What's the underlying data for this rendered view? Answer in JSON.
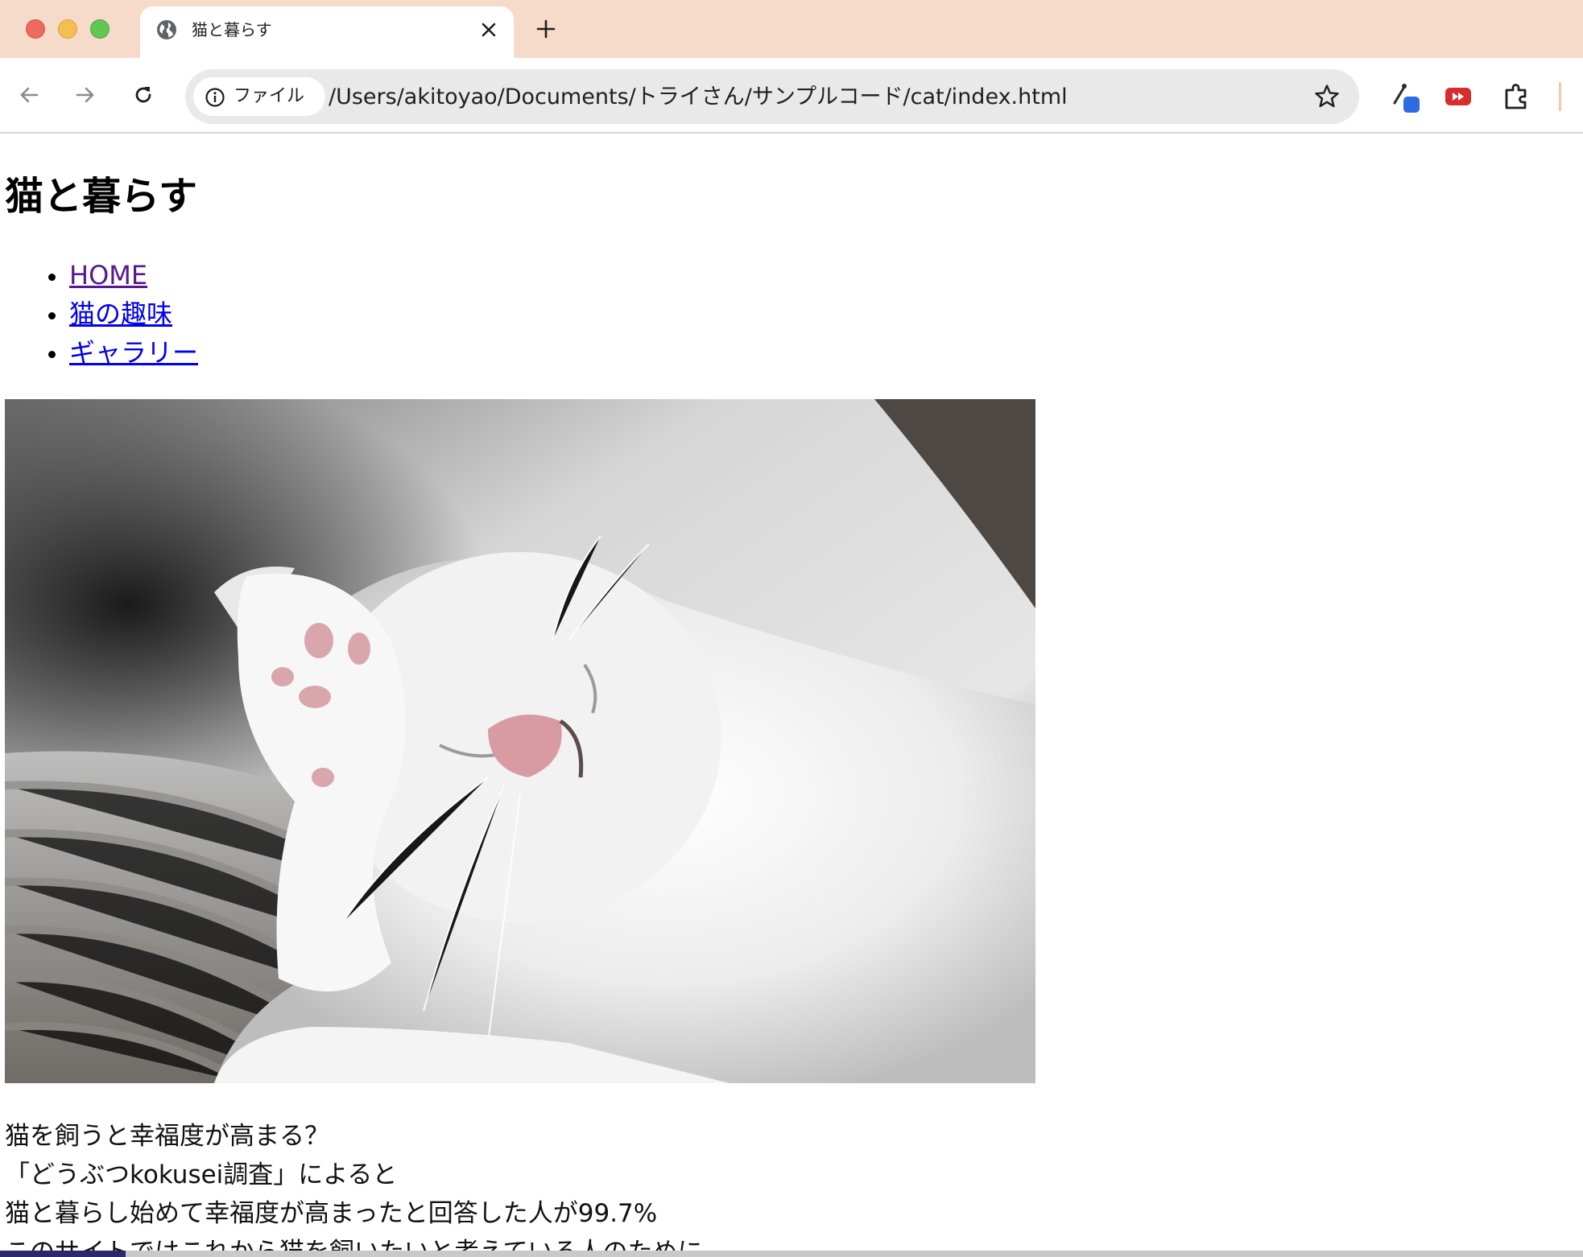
{
  "browser": {
    "tab": {
      "title": "猫と暮らす",
      "favicon": "globe-icon"
    },
    "toolbar": {
      "site_info_label": "ファイル",
      "url": "/Users/akitoyao/Documents/トライさん/サンプルコード/cat/index.html"
    },
    "extensions": [
      "eyedropper-icon",
      "youtube-icon",
      "puzzle-icon"
    ]
  },
  "page": {
    "title": "猫と暮らす",
    "nav": [
      {
        "label": "HOME",
        "visited": true
      },
      {
        "label": "猫の趣味",
        "visited": false
      },
      {
        "label": "ギャラリー",
        "visited": false
      }
    ],
    "hero_image": "white-kitten-sleeping-photo",
    "paragraphs": [
      "猫を飼うと幸福度が高まる？",
      "「どうぶつkokusei調査」によると",
      "猫と暮らし始めて幸福度が高まったと回答した人が99.7%",
      "このサイトではこれから猫を飼いたいと考えている人のために"
    ]
  },
  "colors": {
    "tabbar": "#f7dbca",
    "link": "#0000ee",
    "link_visited": "#551a8b"
  }
}
